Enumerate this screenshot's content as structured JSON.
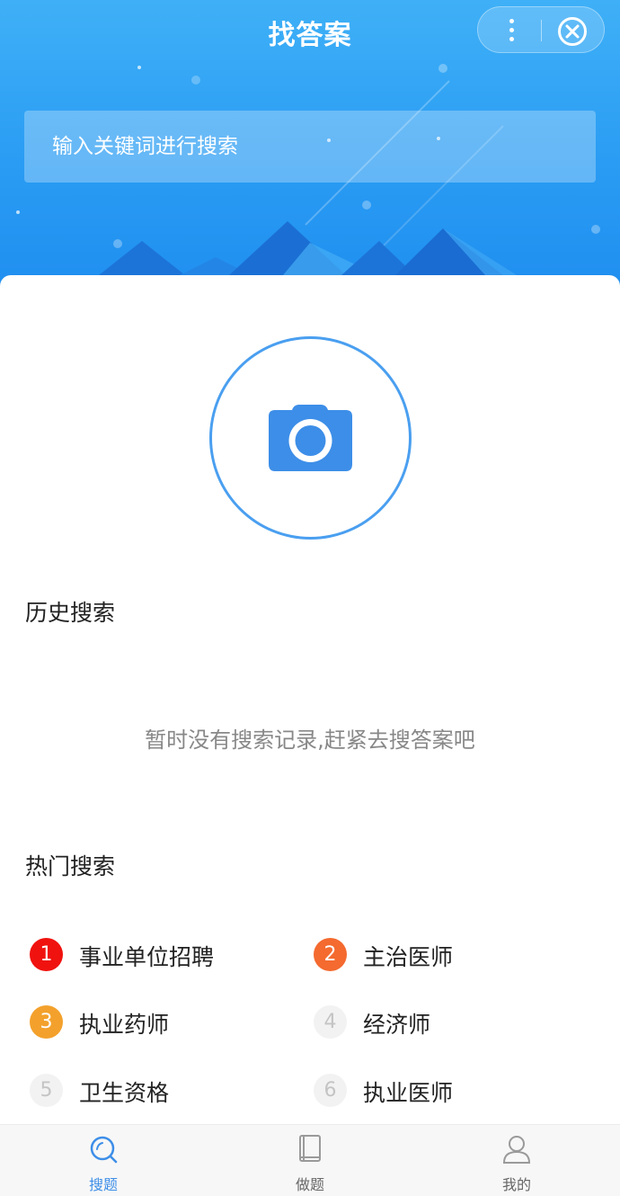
{
  "header": {
    "title": "找答案",
    "search_placeholder": "输入关键词进行搜索"
  },
  "history": {
    "title": "历史搜索",
    "empty_text": "暂时没有搜索记录,赶紧去搜答案吧"
  },
  "hot": {
    "title": "热门搜索",
    "items": [
      {
        "rank": "1",
        "label": "事业单位招聘",
        "color": "#f0120f"
      },
      {
        "rank": "2",
        "label": "主治医师",
        "color": "#f46a2f"
      },
      {
        "rank": "3",
        "label": "执业药师",
        "color": "#f3a12c"
      },
      {
        "rank": "4",
        "label": "经济师",
        "color": "#f2f2f2"
      },
      {
        "rank": "5",
        "label": "卫生资格",
        "color": "#f2f2f2"
      },
      {
        "rank": "6",
        "label": "执业医师",
        "color": "#f2f2f2"
      }
    ]
  },
  "tabbar": {
    "tabs": [
      {
        "label": "搜题",
        "icon": "search-icon",
        "active": true
      },
      {
        "label": "做题",
        "icon": "book-icon",
        "active": false
      },
      {
        "label": "我的",
        "icon": "user-icon",
        "active": false
      }
    ]
  },
  "colors": {
    "accent": "#3d8ee8",
    "header_blue": "#2a9cf3"
  }
}
